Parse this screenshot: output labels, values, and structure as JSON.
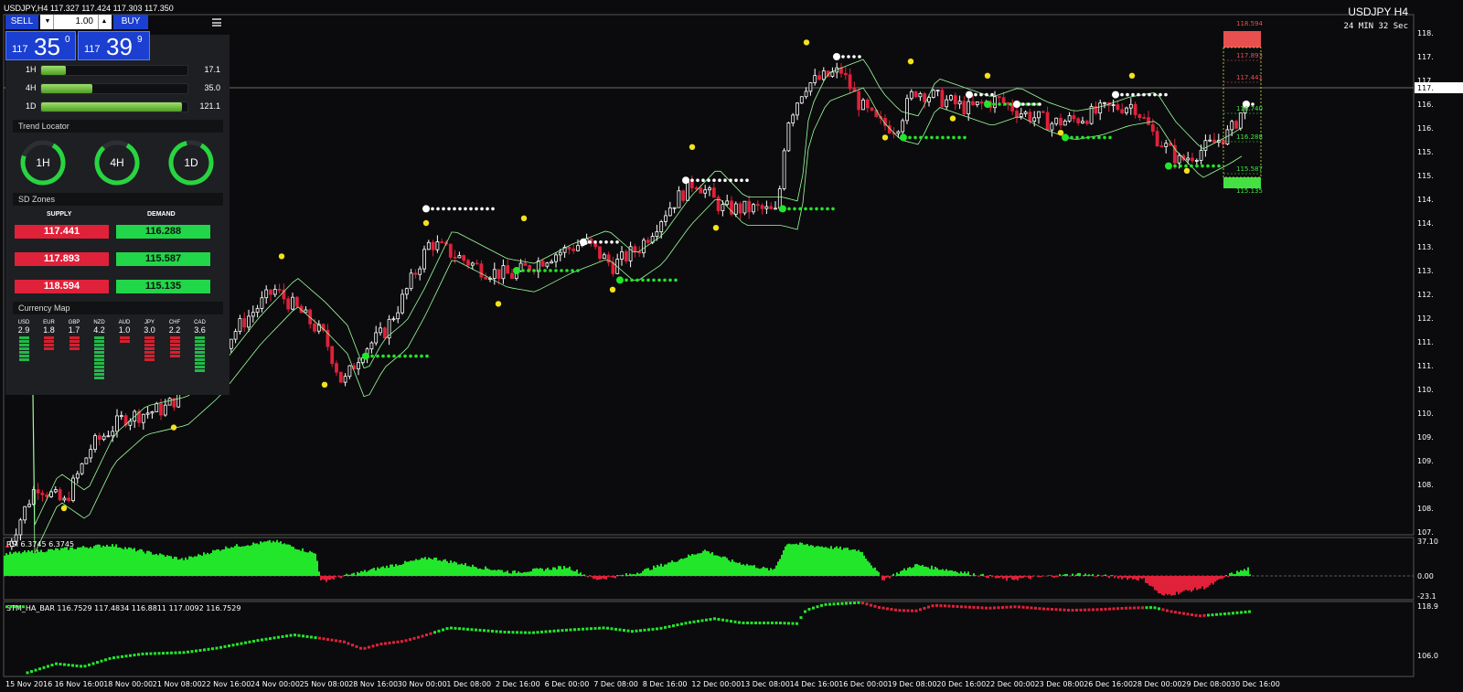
{
  "window": {
    "header": "USDJPY,H4  117.327 117.424 117.303 117.350",
    "symbol_title": "USDJPY H4",
    "countdown": "24 MIN 32 Sec"
  },
  "trade_panel": {
    "sell_label": "SELL",
    "buy_label": "BUY",
    "lot_value": "1.00",
    "bid": {
      "small": "117",
      "big": "35",
      "sup": "0"
    },
    "ask": {
      "small": "117",
      "big": "39",
      "sup": "9"
    }
  },
  "strength": [
    {
      "label": "1H",
      "value": "17.1",
      "fraction": 0.17
    },
    {
      "label": "4H",
      "value": "35.0",
      "fraction": 0.35
    },
    {
      "label": "1D",
      "value": "121.1",
      "fraction": 0.96
    }
  ],
  "trend_locator": {
    "title": "Trend Locator",
    "gauges": [
      {
        "label": "1H",
        "fraction": 0.72
      },
      {
        "label": "4H",
        "fraction": 0.8
      },
      {
        "label": "1D",
        "fraction": 0.88
      }
    ]
  },
  "sd_zones": {
    "title": "SD Zones",
    "supply_header": "SUPPLY",
    "demand_header": "DEMAND",
    "supply": [
      "117.441",
      "117.893",
      "118.594"
    ],
    "demand": [
      "116.288",
      "115.587",
      "115.135"
    ]
  },
  "currency_map": {
    "title": "Currency Map",
    "currencies": [
      {
        "name": "USD",
        "value": "2.9",
        "bars": 7,
        "color": "#22b84a"
      },
      {
        "name": "EUR",
        "value": "1.8",
        "bars": 4,
        "color": "#d4202f"
      },
      {
        "name": "GBP",
        "value": "1.7",
        "bars": 4,
        "color": "#d4202f"
      },
      {
        "name": "NZD",
        "value": "4.2",
        "bars": 12,
        "color": "#22b84a"
      },
      {
        "name": "AUD",
        "value": "1.0",
        "bars": 2,
        "color": "#d4202f"
      },
      {
        "name": "JPY",
        "value": "3.0",
        "bars": 7,
        "color": "#d4202f"
      },
      {
        "name": "CHF",
        "value": "2.2",
        "bars": 6,
        "color": "#d4202f"
      },
      {
        "name": "CAD",
        "value": "3.6",
        "bars": 10,
        "color": "#22b84a"
      }
    ]
  },
  "price_axis": {
    "ticks": [
      "118.",
      "117.",
      "117.",
      "116.",
      "116.",
      "115.",
      "115.",
      "114.",
      "114.",
      "113.",
      "113.",
      "112.",
      "112.",
      "111.",
      "111.",
      "110.",
      "110.",
      "109.",
      "109.",
      "108.",
      "108.",
      "107."
    ],
    "current_price_label": "117."
  },
  "zone_labels_right": [
    "118.594",
    "117.893",
    "117.441",
    "116.740",
    "116.288",
    "115.587",
    "115.135"
  ],
  "rsi_panel": {
    "label": "RSI 6.3745 6.3745",
    "axis": [
      "37.10",
      "0.00",
      "-23.1"
    ]
  },
  "ha_panel": {
    "label": "STM_HA_BAR 116.7529 117.4834 116.8811 117.0092 116.7529",
    "axis": [
      "118.9",
      "106.0"
    ]
  },
  "time_axis": [
    "15 Nov 2016",
    "16 Nov 16:00",
    "18 Nov 00:00",
    "21 Nov 08:00",
    "22 Nov 16:00",
    "24 Nov 00:00",
    "25 Nov 08:00",
    "28 Nov 16:00",
    "30 Nov 00:00",
    "1 Dec 08:00",
    "2 Dec 16:00",
    "6 Dec 00:00",
    "7 Dec 08:00",
    "8 Dec 16:00",
    "12 Dec 00:00",
    "13 Dec 08:00",
    "14 Dec 16:00",
    "16 Dec 00:00",
    "19 Dec 08:00",
    "20 Dec 16:00",
    "22 Dec 00:00",
    "23 Dec 08:00",
    "26 Dec 16:00",
    "28 Dec 00:00",
    "29 Dec 08:00",
    "30 Dec 16:00"
  ],
  "colors": {
    "bull": "#ffffff",
    "bear": "#e0213a",
    "rsi_up": "#22e62a",
    "rsi_down": "#e0213a",
    "band": "#9cff9c"
  }
}
